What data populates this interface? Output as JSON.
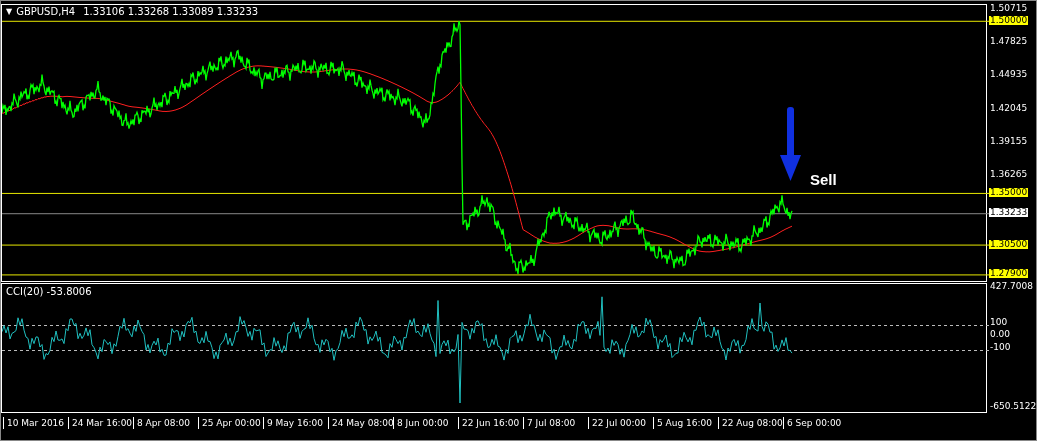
{
  "chart": {
    "header": {
      "menu_glyph": "▼",
      "symbol": "GBPUSD,H4",
      "quotes": "1.33106 1.33268 1.33089 1.33233"
    },
    "price_axis": [
      {
        "label": "1.50715",
        "kind": "tick"
      },
      {
        "label": "1.50000",
        "kind": "level"
      },
      {
        "label": "1.47825",
        "kind": "tick"
      },
      {
        "label": "1.44935",
        "kind": "tick"
      },
      {
        "label": "1.42045",
        "kind": "tick"
      },
      {
        "label": "1.39155",
        "kind": "tick"
      },
      {
        "label": "1.36265",
        "kind": "tick"
      },
      {
        "label": "1.35000",
        "kind": "level"
      },
      {
        "label": "1.33233",
        "kind": "current"
      },
      {
        "label": "1.30500",
        "kind": "level"
      },
      {
        "label": "1.27900",
        "kind": "level"
      }
    ],
    "annotation": {
      "text": "Sell"
    },
    "indicator": {
      "title": "CCI(20) -53.8006",
      "axis": [
        {
          "label": "427.7008",
          "kind": "top"
        },
        {
          "label": "100",
          "kind": "level"
        },
        {
          "label": "0.00",
          "kind": "tick"
        },
        {
          "label": "-100",
          "kind": "level"
        },
        {
          "label": "-650.5122",
          "kind": "bottom"
        }
      ]
    },
    "time_axis": [
      "10 Mar 2016",
      "24 Mar 16:00",
      "8 Apr 08:00",
      "25 Apr 00:00",
      "9 May 16:00",
      "24 May 08:00",
      "8 Jun 00:00",
      "22 Jun 16:00",
      "7 Jul 08:00",
      "22 Jul 00:00",
      "5 Aug 16:00",
      "22 Aug 08:00",
      "6 Sep 00:00"
    ]
  }
}
